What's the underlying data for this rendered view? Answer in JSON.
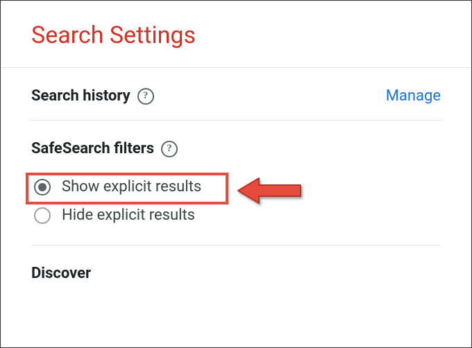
{
  "header": {
    "title": "Search Settings"
  },
  "sections": {
    "searchHistory": {
      "title": "Search history",
      "manageLink": "Manage"
    },
    "safeSearch": {
      "title": "SafeSearch filters",
      "options": [
        {
          "label": "Show explicit results",
          "selected": true
        },
        {
          "label": "Hide explicit results",
          "selected": false
        }
      ]
    },
    "discover": {
      "title": "Discover"
    }
  },
  "annotation": {
    "highlightColor": "#e74c3c"
  }
}
